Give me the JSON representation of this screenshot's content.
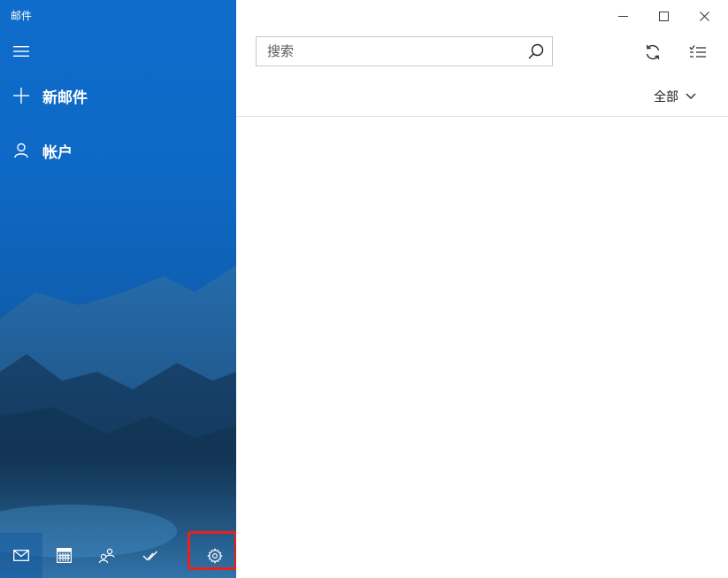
{
  "app": {
    "title": "邮件"
  },
  "nav": {
    "menu_icon": "hamburger-icon",
    "new_mail_label": "新邮件",
    "new_mail_icon": "plus-icon",
    "accounts_label": "帐户",
    "accounts_icon": "person-icon",
    "bottom_bar": [
      {
        "icon": "mail-icon",
        "active": true
      },
      {
        "icon": "calendar-icon",
        "active": false
      },
      {
        "icon": "people-icon",
        "active": false
      },
      {
        "icon": "todo-check-icon",
        "active": false
      },
      {
        "icon": "gear-icon",
        "active": false,
        "highlighted": true
      }
    ]
  },
  "search": {
    "placeholder": "搜索",
    "value": ""
  },
  "toolbar": {
    "sync_icon": "sync-icon",
    "select_icon": "select-mode-icon"
  },
  "filter": {
    "label": "全部"
  },
  "colors": {
    "accent": "#0f6ccb",
    "highlight_border": "#e8211b",
    "divider": "#e3e3e3"
  }
}
